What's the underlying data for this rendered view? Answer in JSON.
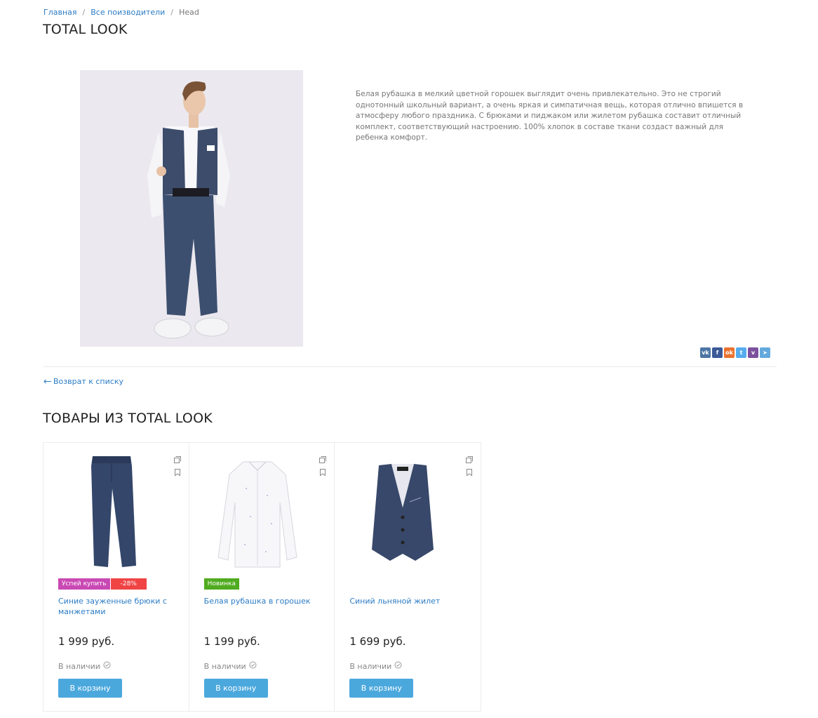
{
  "breadcrumb": {
    "home": "Главная",
    "brands": "Все поизводители",
    "current": "Head",
    "sep": "/"
  },
  "page_title": "TOTAL LOOK",
  "description": "Белая рубашка в мелкий цветной горошек выглядит очень привлекательно. Это не строгий однотонный школьный вариант, а очень яркая и симпатичная вещь, которая отлично впишется в атмосферу любого праздника. С брюками и пиджаком или жилетом рубашка составит отличный комплект, соответствующий настроению. 100% хлопок в составе ткани создаст важный для ребенка комфорт.",
  "share": [
    {
      "icon": "vk-icon",
      "glyph": "vk",
      "color": "#4c75a3"
    },
    {
      "icon": "facebook-icon",
      "glyph": "f",
      "color": "#3b5998"
    },
    {
      "icon": "odnoklassniki-icon",
      "glyph": "ok",
      "color": "#eb722e"
    },
    {
      "icon": "twitter-icon",
      "glyph": "t",
      "color": "#55acee"
    },
    {
      "icon": "viber-icon",
      "glyph": "v",
      "color": "#7b519d"
    },
    {
      "icon": "telegram-icon",
      "glyph": "➤",
      "color": "#64a9dc"
    }
  ],
  "back_link": "Возврат к списку",
  "section_title": "ТОВАРЫ ИЗ TOTAL LOOK",
  "products": [
    {
      "name": "Синие зауженные брюки с манжетами",
      "price": "1 999 руб.",
      "stock": "В наличии",
      "button": "В корзину",
      "badges": [
        {
          "text": "Успей купить",
          "color": "#c949b4"
        },
        {
          "text": "-28%",
          "color": "#f04444"
        }
      ]
    },
    {
      "name": "Белая рубашка в горошек",
      "price": "1 199 руб.",
      "stock": "В наличии",
      "button": "В корзину",
      "badges": [
        {
          "text": "Новинка",
          "color": "#4fab1f"
        }
      ]
    },
    {
      "name": "Синий льняной жилет",
      "price": "1 699 руб.",
      "stock": "В наличии",
      "button": "В корзину",
      "badges": []
    }
  ]
}
